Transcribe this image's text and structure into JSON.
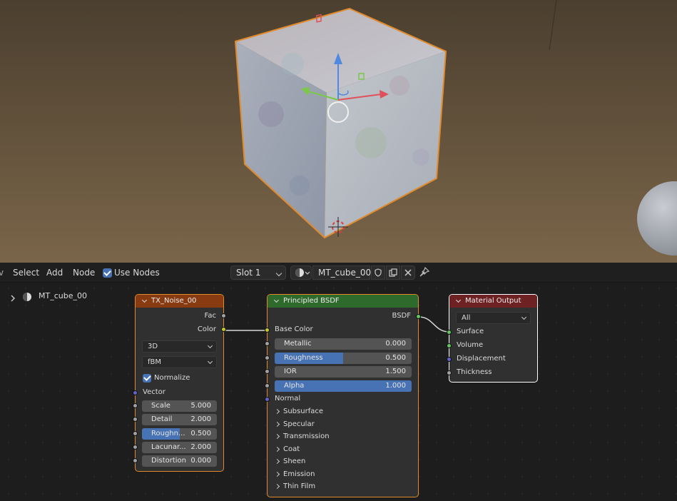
{
  "colors": {
    "selection_orange": "#e08a2c",
    "accent_blue": "#4772b3",
    "socket_shader": "#63c763",
    "socket_color": "#c7c729",
    "socket_vector": "#6363c7",
    "socket_float": "#a1a1a1",
    "header_texture": "#883a11",
    "header_shader": "#2e6a2b",
    "header_output": "#6e2123"
  },
  "header": {
    "menu_select": "Select",
    "menu_add": "Add",
    "menu_node": "Node",
    "use_nodes_label": "Use Nodes",
    "use_nodes_checked": true,
    "slot": "Slot 1",
    "material_name": "MT_cube_00",
    "icons": [
      "material-sphere-icon",
      "fake-user-shield-icon",
      "duplicate-icon",
      "close-icon",
      "pin-icon"
    ]
  },
  "outliner": {
    "material_name": "MT_cube_00"
  },
  "nodes": {
    "noise": {
      "title": "TX_Noise_00",
      "out_fac": "Fac",
      "out_color": "Color",
      "dimensions": "3D",
      "type": "fBM",
      "normalize_label": "Normalize",
      "normalize_checked": true,
      "in_vector": "Vector",
      "fields": [
        {
          "label": "Scale",
          "value": "5.000"
        },
        {
          "label": "Detail",
          "value": "2.000"
        },
        {
          "label": "Roughn...",
          "value": "0.500",
          "fill": 0.5
        },
        {
          "label": "Lacunar...",
          "value": "2.000"
        },
        {
          "label": "Distortion",
          "value": "0.000"
        }
      ]
    },
    "bsdf": {
      "title": "Principled BSDF",
      "out_bsdf": "BSDF",
      "in_base_color": "Base Color",
      "fields": [
        {
          "label": "Metallic",
          "value": "0.000",
          "fill": 0
        },
        {
          "label": "Roughness",
          "value": "0.500",
          "fill": 0.5
        },
        {
          "label": "IOR",
          "value": "1.500",
          "fill": 0
        },
        {
          "label": "Alpha",
          "value": "1.000",
          "fill": 1
        }
      ],
      "in_normal": "Normal",
      "panels": [
        "Subsurface",
        "Specular",
        "Transmission",
        "Coat",
        "Sheen",
        "Emission",
        "Thin Film"
      ]
    },
    "output": {
      "title": "Material Output",
      "target": "All",
      "inputs": [
        "Surface",
        "Volume",
        "Displacement",
        "Thickness"
      ]
    }
  }
}
